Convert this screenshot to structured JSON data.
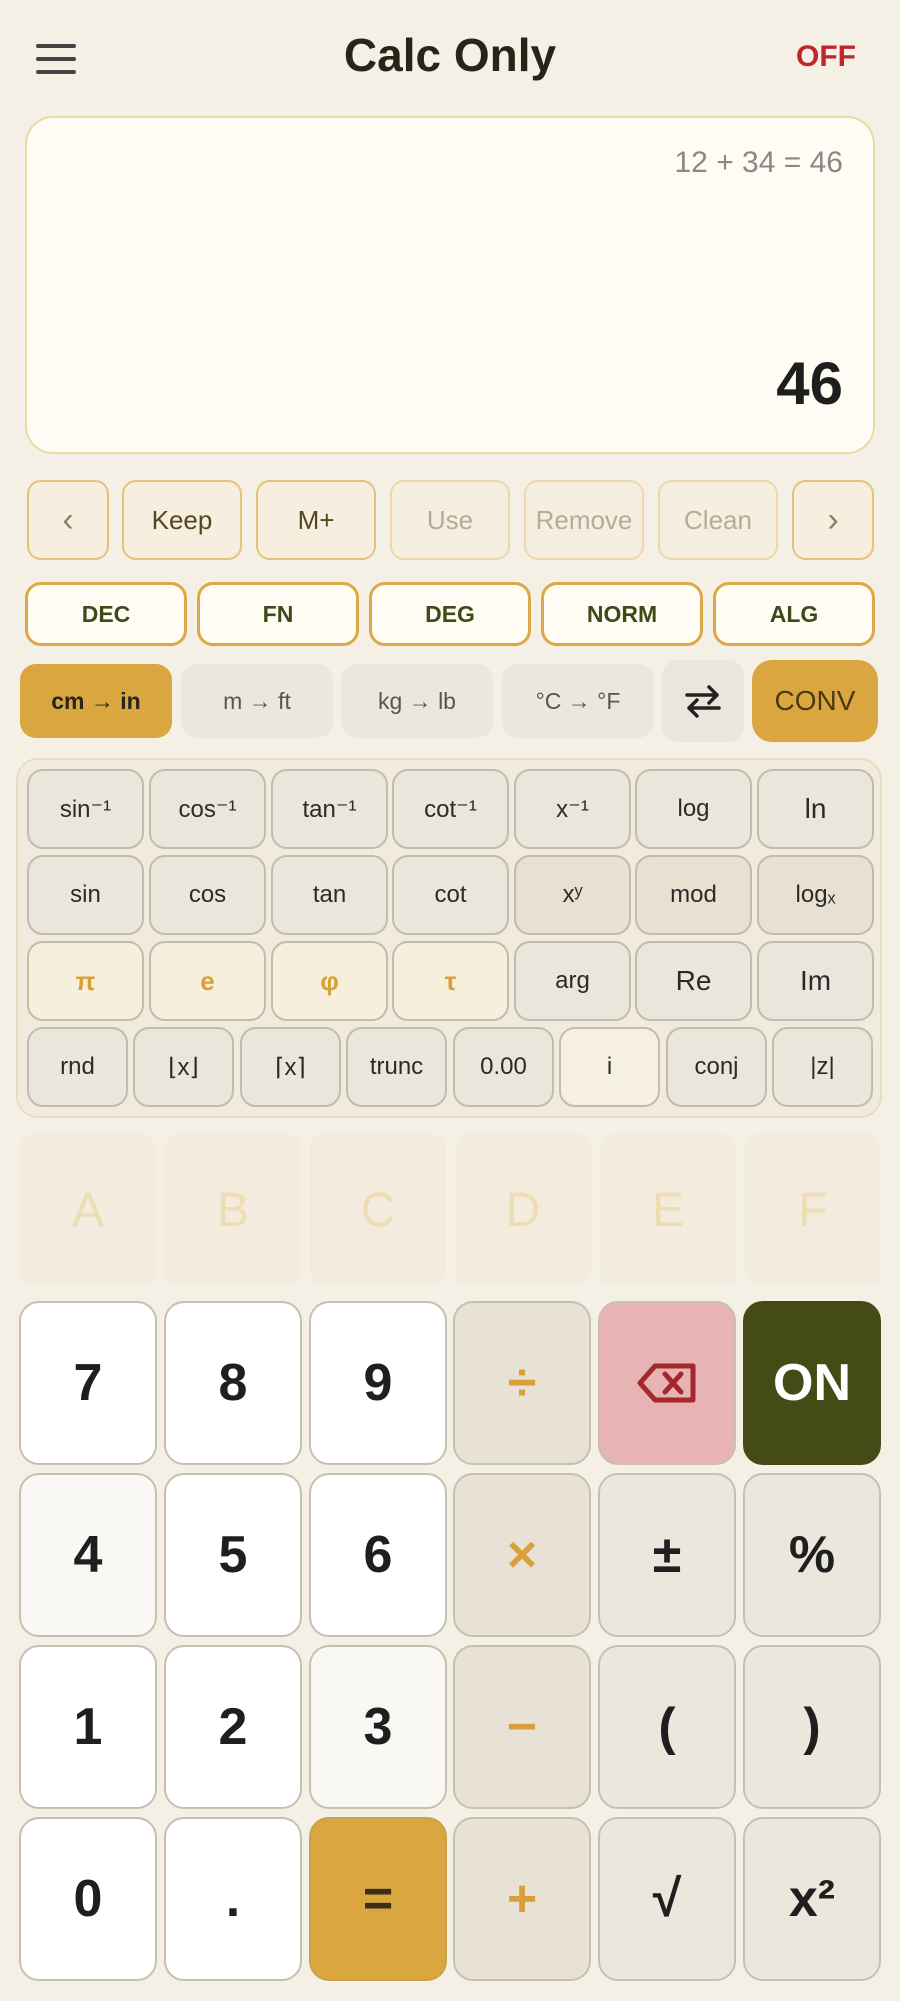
{
  "header": {
    "title": "Calc Only",
    "off_label": "OFF",
    "menu_icon": "hamburger-menu-icon"
  },
  "display": {
    "expression": "12 + 34 = 46",
    "result": "46"
  },
  "history": {
    "prev_icon": "chevron-left-icon",
    "next_icon": "chevron-right-icon",
    "keep": "Keep",
    "mplus": "M+",
    "use": "Use",
    "remove": "Remove",
    "clean": "Clean"
  },
  "modes": {
    "dec": "DEC",
    "fn": "FN",
    "deg": "DEG",
    "norm": "NORM",
    "alg": "ALG"
  },
  "conversions": {
    "active_index": 0,
    "items": [
      "cm → in",
      "m → ft",
      "kg → lb",
      "°C → °F"
    ],
    "swap_icon": "swap-arrows-icon",
    "conv_label": "CONV"
  },
  "scientific": {
    "row1": [
      "sin⁻¹",
      "cos⁻¹",
      "tan⁻¹",
      "cot⁻¹",
      "x⁻¹",
      "log",
      "ln"
    ],
    "row2": [
      "sin",
      "cos",
      "tan",
      "cot",
      "xʸ",
      "mod",
      "logₓ"
    ],
    "row3": [
      "π",
      "e",
      "φ",
      "τ",
      "arg",
      "Re",
      "Im"
    ],
    "row4": [
      "rnd",
      "⌊x⌋",
      "⌈x⌉",
      "trunc",
      "0.00",
      "i",
      "conj",
      "|z|"
    ]
  },
  "hex_keys": [
    "A",
    "B",
    "C",
    "D",
    "E",
    "F"
  ],
  "keypad": {
    "row1": [
      "7",
      "8",
      "9",
      "÷",
      "⌫",
      "ON"
    ],
    "row2": [
      "4",
      "5",
      "6",
      "×",
      "±",
      "%"
    ],
    "row3": [
      "1",
      "2",
      "3",
      "−",
      "(",
      ")"
    ],
    "row4": [
      "0",
      ".",
      "=",
      "+",
      "√",
      "x²"
    ],
    "backspace_icon": "backspace-icon"
  },
  "colors": {
    "accent": "#d9a63f",
    "off_red": "#c0262a",
    "on_green": "#444b16",
    "delete_pink": "#e7b3b3"
  }
}
